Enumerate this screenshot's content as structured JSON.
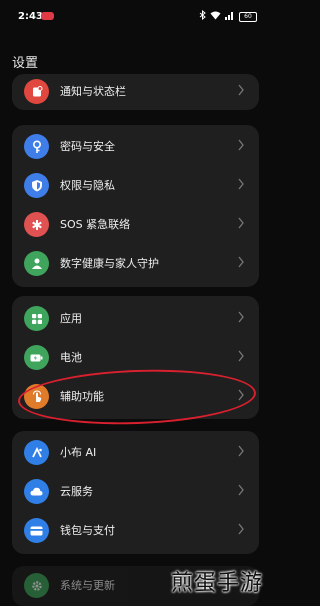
{
  "status_bar": {
    "time": "2:43",
    "battery": "60"
  },
  "page": {
    "title": "设置"
  },
  "groups": [
    {
      "items": [
        {
          "label": "通知与状态栏",
          "icon": "notification-icon",
          "color": "#e0473e"
        }
      ]
    },
    {
      "items": [
        {
          "label": "密码与安全",
          "icon": "key-icon",
          "color": "#3f7ee8"
        },
        {
          "label": "权限与隐私",
          "icon": "shield-icon",
          "color": "#3f7ee8"
        },
        {
          "label": "SOS 紧急联络",
          "icon": "asterisk-icon",
          "color": "#e05252"
        },
        {
          "label": "数字健康与家人守护",
          "icon": "family-icon",
          "color": "#3fa45c"
        }
      ]
    },
    {
      "items": [
        {
          "label": "应用",
          "icon": "apps-grid-icon",
          "color": "#3fa45c"
        },
        {
          "label": "电池",
          "icon": "battery-icon",
          "color": "#3fa45c"
        },
        {
          "label": "辅助功能",
          "icon": "accessibility-hand-icon",
          "color": "#e07b2a"
        }
      ]
    },
    {
      "items": [
        {
          "label": "小布 AI",
          "icon": "assistant-icon",
          "color": "#2f7fe6"
        },
        {
          "label": "云服务",
          "icon": "cloud-icon",
          "color": "#2f7fe6"
        },
        {
          "label": "钱包与支付",
          "icon": "wallet-icon",
          "color": "#2f7fe6"
        }
      ]
    },
    {
      "items": [
        {
          "label": "系统与更新",
          "icon": "gear-icon",
          "color": "#3fa45c"
        }
      ]
    }
  ],
  "watermark": "煎蛋手游"
}
